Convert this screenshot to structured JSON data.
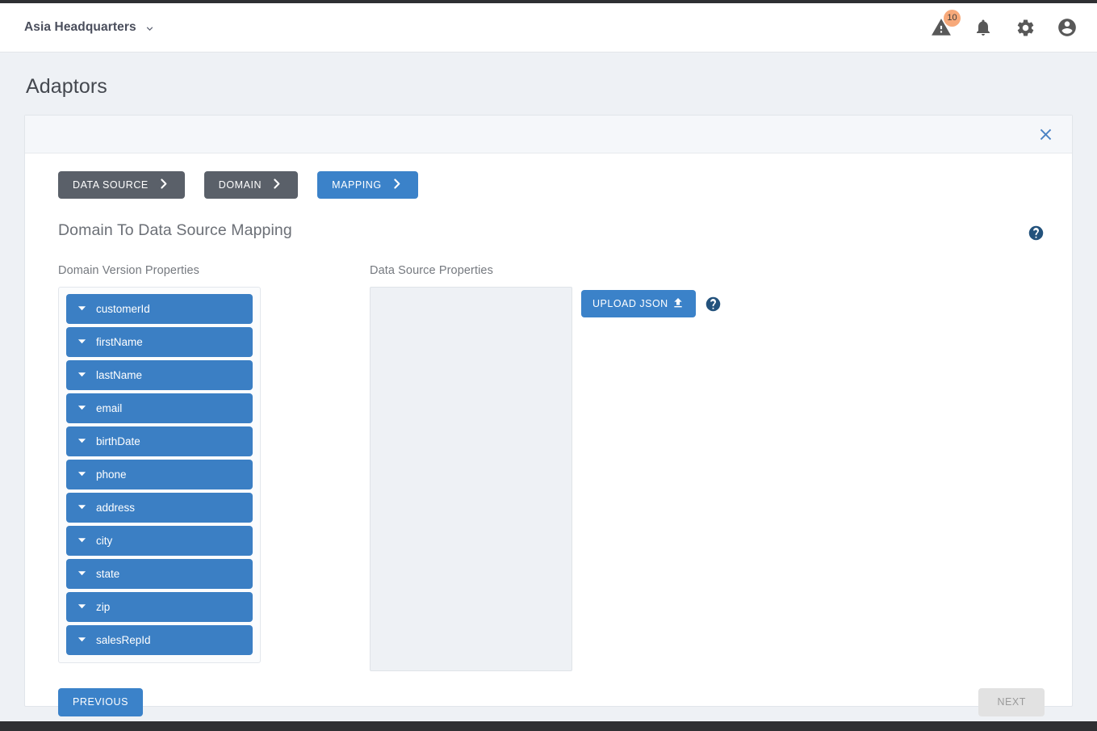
{
  "topbar": {
    "org_name": "Asia Headquarters",
    "org_caret_icon": "chevron-down-icon",
    "alerts": {
      "icon": "warning-triangle-icon",
      "badge_count": "10",
      "badge_color": "#f7a97a"
    },
    "notifications_icon": "bell-icon",
    "settings_icon": "gear-icon",
    "account_icon": "account-circle-icon"
  },
  "page": {
    "title": "Adaptors"
  },
  "card": {
    "close_icon": "close-icon",
    "help_icon": "help-circle-icon"
  },
  "stepper": {
    "steps": [
      {
        "label": "DATA SOURCE",
        "state": "inactive",
        "chevron_icon": "chevron-right-icon"
      },
      {
        "label": "DOMAIN",
        "state": "inactive",
        "chevron_icon": "chevron-right-icon"
      },
      {
        "label": "MAPPING",
        "state": "active",
        "chevron_icon": "chevron-right-icon"
      }
    ],
    "active_color": "#3b82c9",
    "inactive_color": "#5a6069"
  },
  "mapping": {
    "section_title": "Domain To Data Source Mapping",
    "domain_column": {
      "label": "Domain Version Properties",
      "item_color": "#3b7fc4",
      "item_caret_icon": "caret-down-icon",
      "items": [
        {
          "name": "customerId"
        },
        {
          "name": "firstName"
        },
        {
          "name": "lastName"
        },
        {
          "name": "email"
        },
        {
          "name": "birthDate"
        },
        {
          "name": "phone"
        },
        {
          "name": "address"
        },
        {
          "name": "city"
        },
        {
          "name": "state"
        },
        {
          "name": "zip"
        },
        {
          "name": "salesRepId"
        }
      ]
    },
    "source_column": {
      "label": "Data Source Properties",
      "items": [],
      "upload_button": {
        "label": "UPLOAD JSON",
        "icon": "upload-icon"
      },
      "help_icon": "help-circle-icon"
    }
  },
  "footer": {
    "previous_label": "PREVIOUS",
    "next_label": "NEXT",
    "next_disabled": true
  }
}
